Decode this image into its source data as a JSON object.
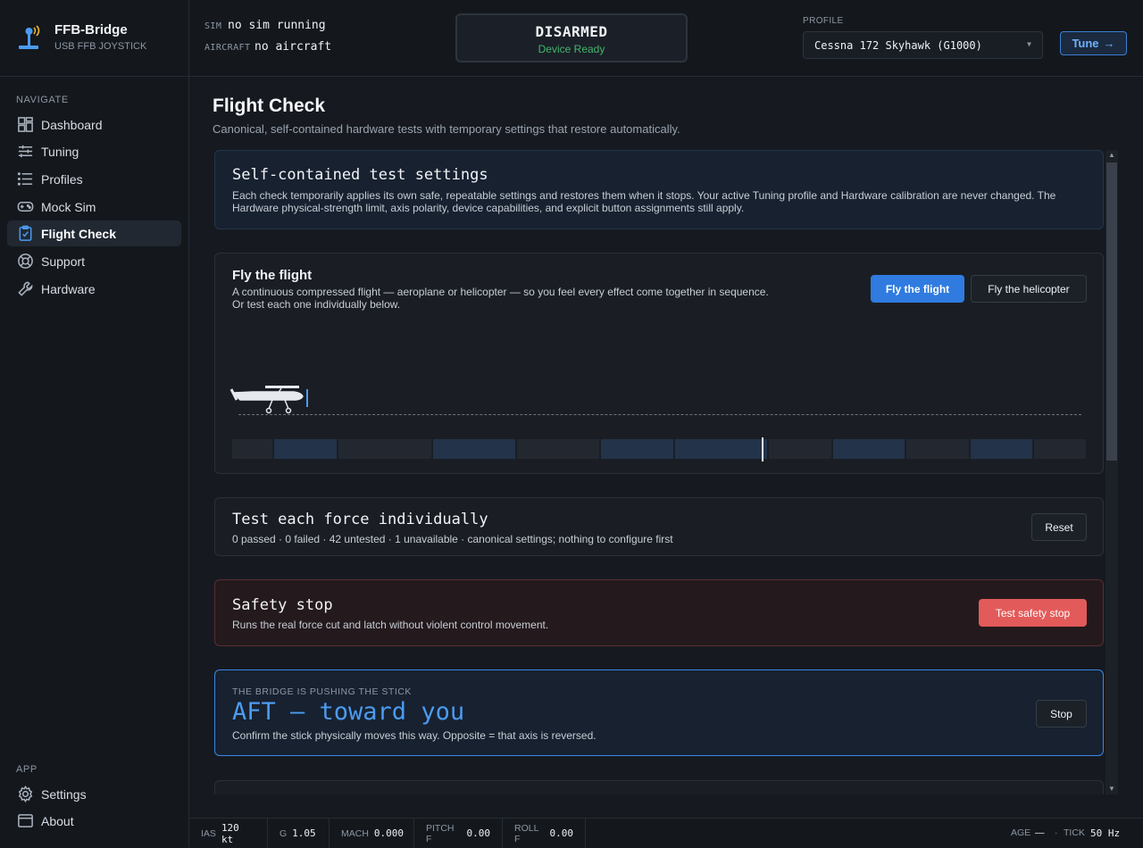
{
  "brand": {
    "name": "FFB-Bridge",
    "subtitle": "USB FFB JOYSTICK"
  },
  "nav": {
    "section_label": "NAVIGATE",
    "items": [
      {
        "label": "Dashboard",
        "icon": "dashboard-icon"
      },
      {
        "label": "Tuning",
        "icon": "sliders-icon"
      },
      {
        "label": "Profiles",
        "icon": "list-icon"
      },
      {
        "label": "Mock Sim",
        "icon": "gamepad-icon"
      },
      {
        "label": "Flight Check",
        "icon": "clipboard-check-icon",
        "active": true
      },
      {
        "label": "Support",
        "icon": "lifebuoy-icon"
      },
      {
        "label": "Hardware",
        "icon": "wrench-icon"
      }
    ],
    "app_label": "APP",
    "app_items": [
      {
        "label": "Settings",
        "icon": "gear-icon"
      },
      {
        "label": "About",
        "icon": "window-icon"
      }
    ]
  },
  "topbar": {
    "sim_key": "SIM",
    "sim_value": "no sim running",
    "aircraft_key": "AIRCRAFT",
    "aircraft_value": "no aircraft",
    "status_main": "DISARMED",
    "status_sub": "Device Ready",
    "profile_key": "PROFILE",
    "profile_value": "Cessna 172 Skyhawk (G1000)",
    "tune_label": "Tune"
  },
  "page": {
    "title": "Flight Check",
    "subtitle": "Canonical, self-contained hardware tests with temporary settings that restore automatically."
  },
  "settings_card": {
    "title": "Self-contained test settings",
    "text_1": "Each check temporarily applies its own safe, repeatable settings and restores them when it stops. Your active Tuning profile and Hardware calibration are never changed. The",
    "text_2": "Hardware physical-strength limit, axis polarity, device capabilities, and explicit button assignments still apply."
  },
  "flight_card": {
    "title": "Fly the flight",
    "text_1": "A continuous compressed flight — aeroplane or helicopter — so you feel every effect come together in sequence.",
    "text_2": "Or test each one individually below.",
    "primary_label": "Fly the flight",
    "secondary_label": "Fly the helicopter",
    "progress": 0.62
  },
  "individual_card": {
    "title": "Test each force individually",
    "summary": "0 passed · 0 failed · 42 untested · 1 unavailable · canonical settings; nothing to configure first",
    "reset_label": "Reset"
  },
  "safety_card": {
    "title": "Safety stop",
    "text": "Runs the real force cut and latch without violent control movement.",
    "button_label": "Test safety stop"
  },
  "push_card": {
    "eyebrow": "THE BRIDGE IS PUSHING THE STICK",
    "direction": "AFT — toward you",
    "text": "Confirm the stick physically moves this way. Opposite = that axis is reversed.",
    "stop_label": "Stop"
  },
  "telemetry": [
    {
      "key": "IAS",
      "value": "120 kt"
    },
    {
      "key": "G",
      "value": "1.05"
    },
    {
      "key": "MACH",
      "value": "0.000"
    },
    {
      "key": "PITCH F",
      "value": "0.00"
    },
    {
      "key": "ROLL F",
      "value": "0.00"
    }
  ],
  "telemetry_right": {
    "age_key": "AGE",
    "age_value": "—",
    "dot": "·",
    "tick_key": "TICK",
    "tick_value": "50 Hz"
  },
  "colors": {
    "accent": "#2f7be0",
    "ready": "#43b56c",
    "danger": "#e35a5a"
  }
}
